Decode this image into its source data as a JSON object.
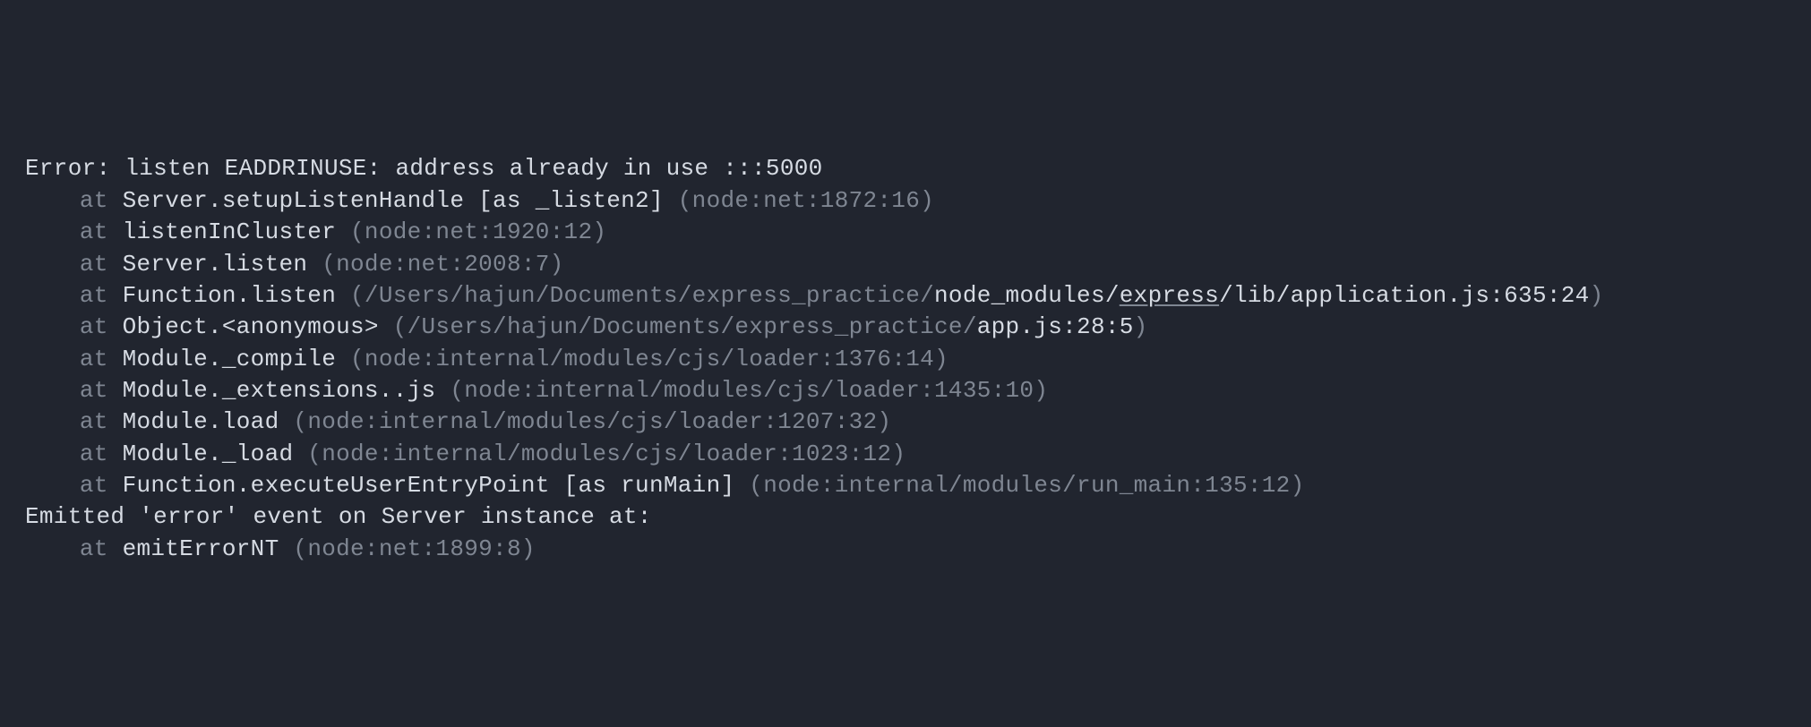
{
  "trace": {
    "error": {
      "prefix": "Error: listen EADDRINUSE: address already in use :::5000"
    },
    "frames": [
      {
        "at": "at ",
        "fn": "Server.setupListenHandle [as _listen2]",
        "loc_open": " (",
        "loc_dim": "node:net:1872:16",
        "loc_bright_tail": "",
        "loc_close": ")"
      },
      {
        "at": "at ",
        "fn": "listenInCluster",
        "loc_open": " (",
        "loc_dim": "node:net:1920:12",
        "loc_bright_tail": "",
        "loc_close": ")"
      },
      {
        "at": "at ",
        "fn": "Server.listen",
        "loc_open": " (",
        "loc_dim": "node:net:2008:7",
        "loc_bright_tail": "",
        "loc_close": ")"
      },
      {
        "at": "at ",
        "fn": "Function.listen",
        "loc_open": " (",
        "loc_dim": "/Users/hajun/Documents/express_practice/",
        "loc_bright_tail": "node_modules/",
        "underline_part": "express",
        "loc_bright_tail2": "/lib/application.js:635:24",
        "loc_close": ")"
      },
      {
        "at": "at ",
        "fn": "Object.<anonymous>",
        "loc_open": " (",
        "loc_dim": "/Users/hajun/Documents/express_practice/",
        "loc_bright_tail": "app.js:28:5",
        "loc_close": ")"
      },
      {
        "at": "at ",
        "fn": "Module._compile",
        "loc_open": " (",
        "loc_dim": "node:internal/modules/cjs/loader:1376:14",
        "loc_bright_tail": "",
        "loc_close": ")"
      },
      {
        "at": "at ",
        "fn": "Module._extensions..js",
        "loc_open": " (",
        "loc_dim": "node:internal/modules/cjs/loader:1435:10",
        "loc_bright_tail": "",
        "loc_close": ")"
      },
      {
        "at": "at ",
        "fn": "Module.load",
        "loc_open": " (",
        "loc_dim": "node:internal/modules/cjs/loader:1207:32",
        "loc_bright_tail": "",
        "loc_close": ")"
      },
      {
        "at": "at ",
        "fn": "Module._load",
        "loc_open": " (",
        "loc_dim": "node:internal/modules/cjs/loader:1023:12",
        "loc_bright_tail": "",
        "loc_close": ")"
      },
      {
        "at": "at ",
        "fn": "Function.executeUserEntryPoint [as runMain]",
        "loc_open": " (",
        "loc_dim": "node:internal/modules/run_main:135:12",
        "loc_bright_tail": "",
        "loc_close": ")"
      }
    ],
    "emitted": "Emitted 'error' event on Server instance at:",
    "emitted_frames": [
      {
        "at": "at ",
        "fn": "emitErrorNT",
        "loc_open": " (",
        "loc_dim": "node:net:1899:8",
        "loc_bright_tail": "",
        "loc_close": ")"
      }
    ]
  }
}
